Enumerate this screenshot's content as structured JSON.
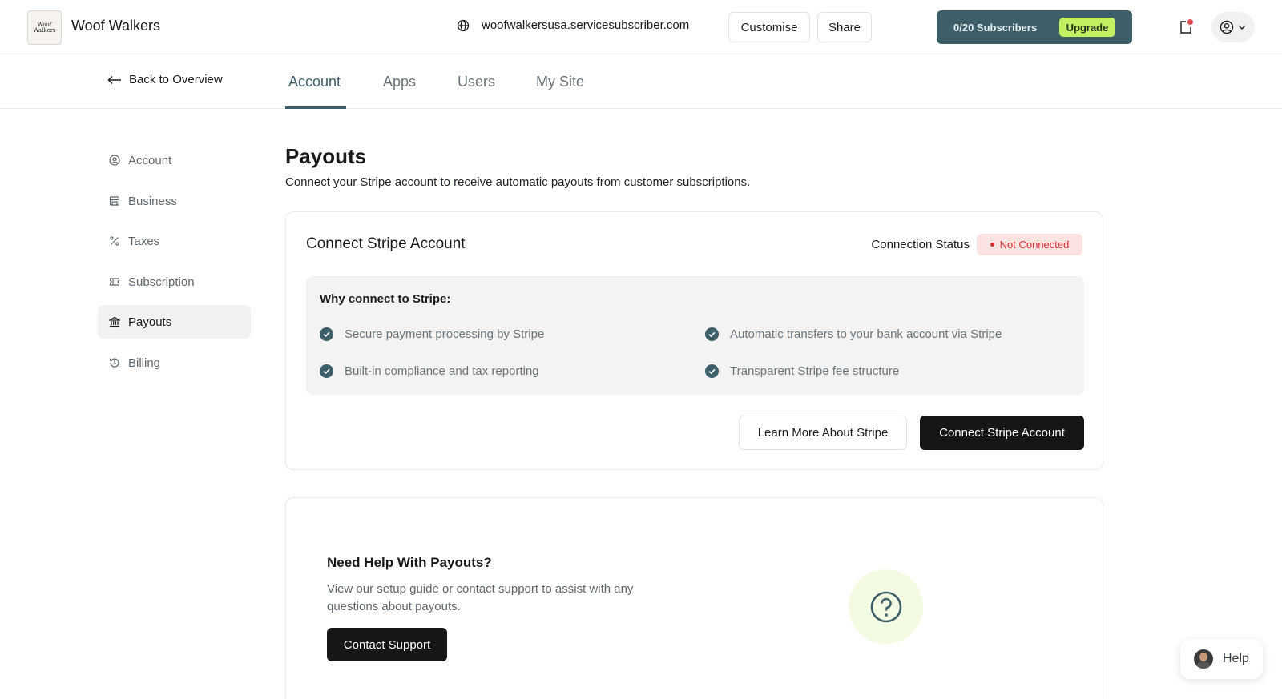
{
  "header": {
    "brand": "Woof Walkers",
    "logo_text": "Woof Walkers",
    "site_url": "woofwalkersusa.servicesubscriber.com",
    "customise_label": "Customise",
    "share_label": "Share",
    "subscribers": "0/20 Subscribers",
    "upgrade_label": "Upgrade"
  },
  "nav": {
    "back_label": "Back to Overview",
    "tabs": [
      {
        "label": "Account"
      },
      {
        "label": "Apps"
      },
      {
        "label": "Users"
      },
      {
        "label": "My Site"
      }
    ]
  },
  "sidebar": {
    "items": [
      {
        "label": "Account",
        "icon": "user-circle-icon"
      },
      {
        "label": "Business",
        "icon": "store-icon"
      },
      {
        "label": "Taxes",
        "icon": "percent-icon"
      },
      {
        "label": "Subscription",
        "icon": "ticket-icon"
      },
      {
        "label": "Payouts",
        "icon": "bank-icon"
      },
      {
        "label": "Billing",
        "icon": "history-icon"
      }
    ]
  },
  "main": {
    "title": "Payouts",
    "subtitle": "Connect your Stripe account to receive automatic payouts from customer subscriptions.",
    "connect_card": {
      "title": "Connect Stripe Account",
      "status_label": "Connection Status",
      "status_value": "Not Connected",
      "why_title": "Why connect to Stripe:",
      "benefits": [
        "Secure payment processing by Stripe",
        "Automatic transfers to your bank account via Stripe",
        "Built-in compliance and tax reporting",
        "Transparent Stripe fee structure"
      ],
      "learn_more_label": "Learn More About Stripe",
      "connect_label": "Connect Stripe Account"
    },
    "help_card": {
      "title": "Need Help With Payouts?",
      "description": "View our setup guide or contact support to assist with any questions about payouts.",
      "contact_label": "Contact Support"
    }
  },
  "help_widget": {
    "label": "Help"
  },
  "colors": {
    "accent": "#3d5f6a",
    "upgrade": "#c3ef63",
    "danger": "#d32f2f",
    "dark_button": "#161616"
  }
}
